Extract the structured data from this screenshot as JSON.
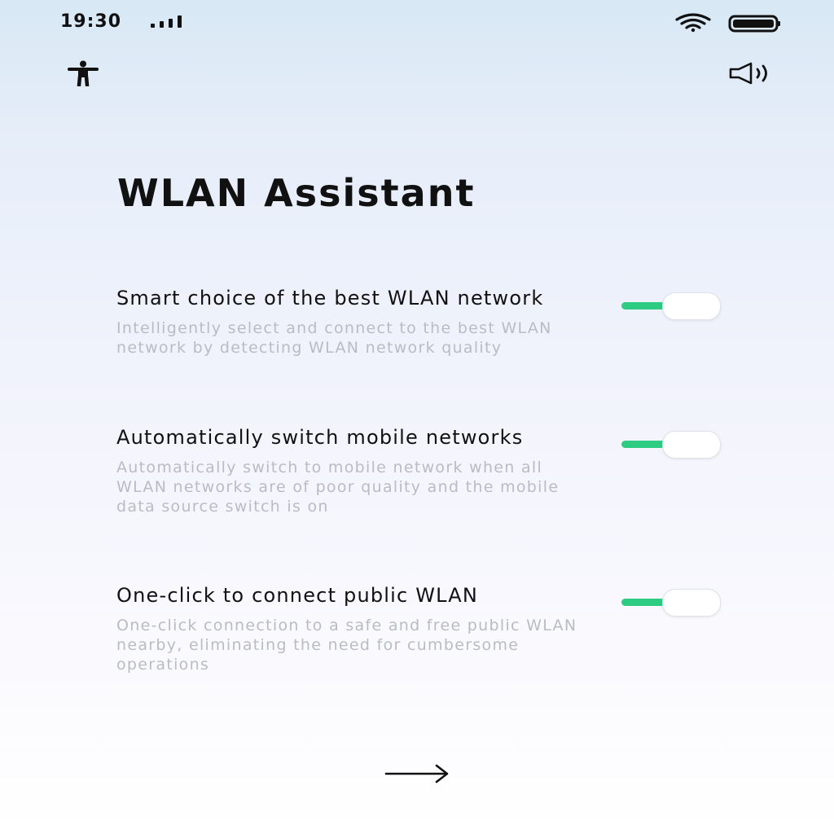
{
  "status_bar": {
    "time": "19:30",
    "icons": [
      "signal-icon",
      "wifi-icon",
      "battery-icon"
    ]
  },
  "header": {
    "left_icon": "accessibility-icon",
    "right_icon": "speaker-icon"
  },
  "page": {
    "title": "WLAN Assistant"
  },
  "options": [
    {
      "title": "Smart choice of the best WLAN network",
      "description": "Intelligently select and connect to the best WLAN network by detecting WLAN network quality",
      "enabled": true
    },
    {
      "title": "Automatically switch mobile networks",
      "description": "Automatically switch to mobile network when all WLAN networks are of poor quality and the mobile data source switch is on",
      "enabled": true
    },
    {
      "title": "One-click to connect public WLAN",
      "description": "One-click connection to a safe and free public WLAN nearby, eliminating the need for cumbersome operations",
      "enabled": true
    }
  ],
  "footer": {
    "next_icon": "arrow-right-icon"
  },
  "colors": {
    "toggle_on": "#2ecb83",
    "description_text": "#b9bcc2",
    "title_text": "#111111"
  }
}
